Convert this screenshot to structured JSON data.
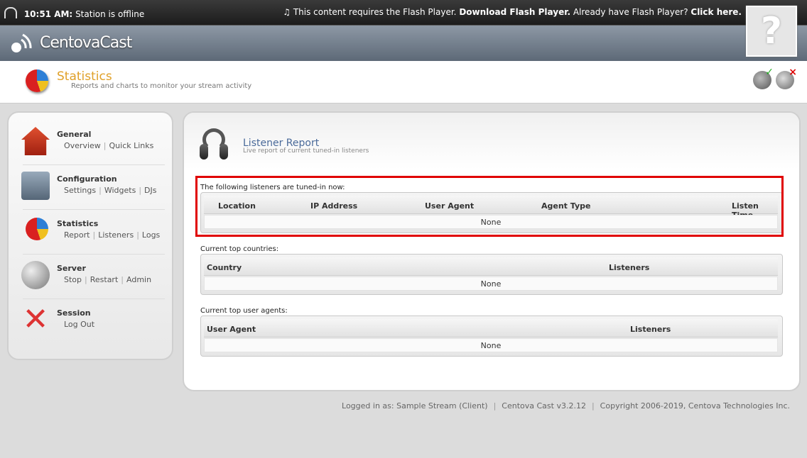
{
  "topbar": {
    "time": "10:51 AM:",
    "status": "Station is offline",
    "flash_prefix": "This content requires the Flash Player.",
    "flash_download": "Download Flash Player.",
    "flash_middle": "Already have Flash Player?",
    "flash_click": "Click here.",
    "help_glyph": "?"
  },
  "brand": {
    "name": "CentovaCast"
  },
  "page": {
    "title": "Statistics",
    "subtitle": "Reports and charts to monitor your stream activity"
  },
  "sidebar": {
    "groups": [
      {
        "title": "General",
        "links": [
          "Overview",
          "Quick Links"
        ],
        "icon": "house-icon"
      },
      {
        "title": "Configuration",
        "links": [
          "Settings",
          "Widgets",
          "DJs"
        ],
        "icon": "config-icon"
      },
      {
        "title": "Statistics",
        "links": [
          "Report",
          "Listeners",
          "Logs"
        ],
        "icon": "pie-chart-icon"
      },
      {
        "title": "Server",
        "links": [
          "Stop",
          "Restart",
          "Admin"
        ],
        "icon": "satellite-dish-icon"
      },
      {
        "title": "Session",
        "links": [
          "Log Out"
        ],
        "icon": "close-icon"
      }
    ]
  },
  "report": {
    "title": "Listener Report",
    "subtitle": "Live report of current tuned-in listeners",
    "listeners": {
      "label": "The following listeners are tuned-in now:",
      "columns": [
        "Location",
        "IP Address",
        "User Agent",
        "Agent Type",
        "Listen Time"
      ],
      "empty": "None"
    },
    "countries": {
      "label": "Current top countries:",
      "columns": [
        "Country",
        "Listeners"
      ],
      "empty": "None"
    },
    "agents": {
      "label": "Current top user agents:",
      "columns": [
        "User Agent",
        "Listeners"
      ],
      "empty": "None"
    }
  },
  "footer": {
    "logged_in": "Logged in as: Sample Stream (Client)",
    "version": "Centova Cast v3.2.12",
    "copyright": "Copyright 2006-2019, Centova Technologies Inc."
  },
  "colors": {
    "highlight": "#e00000",
    "title": "#e0a028",
    "report_title": "#4a6a9a"
  }
}
